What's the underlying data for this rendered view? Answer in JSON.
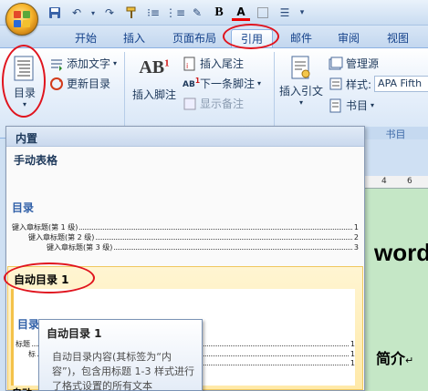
{
  "quick_access": {
    "icons": [
      "save-icon",
      "undo-icon",
      "redo-icon",
      "format-painter-icon",
      "bullets-icon",
      "numbering-icon",
      "highlight-icon",
      "bold-icon",
      "font-color-icon",
      "borders-icon",
      "align-icon"
    ],
    "bold_label": "B",
    "font_color_label": "A"
  },
  "tabs": [
    {
      "label": "开始"
    },
    {
      "label": "插入"
    },
    {
      "label": "页面布局"
    },
    {
      "label": "引用",
      "active": true
    },
    {
      "label": "邮件"
    },
    {
      "label": "审阅"
    },
    {
      "label": "视图"
    }
  ],
  "ribbon": {
    "toc_button": "目录",
    "add_text": "添加文字",
    "update_toc": "更新目录",
    "insert_footnote": "插入脚注",
    "ab_badge": "AB",
    "ab_sup": "1",
    "insert_endnote": "插入尾注",
    "next_footnote": "下一条脚注",
    "show_notes": "显示备注",
    "insert_citation": "插入引文",
    "manage_sources": "管理源",
    "style_label": "样式:",
    "style_value": "APA Fifth",
    "bibliography": "书目",
    "group_title_fragment": "书目"
  },
  "ruler": {
    "marks": [
      "4",
      "6"
    ]
  },
  "document": {
    "heading_fragment": "word",
    "intro_label": "简介",
    "para_mark": "↵"
  },
  "dropdown": {
    "header": "内置",
    "manual_section": "手动表格",
    "manual_preview": {
      "title": "目录",
      "lines": [
        {
          "text": "键入章标题(第 1 级)",
          "page": "1",
          "indent": 0
        },
        {
          "text": "键入章标题(第 2 级)",
          "page": "2",
          "indent": 1
        },
        {
          "text": "键入章标题(第 3 级)",
          "page": "3",
          "indent": 2
        }
      ]
    },
    "auto_item_label": "自动目录 1",
    "auto_preview": {
      "title": "目录",
      "lines": [
        {
          "text": "标题",
          "page": "1",
          "indent": 0
        },
        {
          "text": "标",
          "page": "1",
          "indent": 1
        },
        {
          "text": "",
          "page": "1",
          "indent": 2
        }
      ]
    },
    "bottom_fragment": "自动"
  },
  "tooltip": {
    "title": "自动目录 1",
    "body": "自动目录内容(其标签为“内容”)，包含用标题 1-3 样式进行了格式设置的所有文本"
  }
}
